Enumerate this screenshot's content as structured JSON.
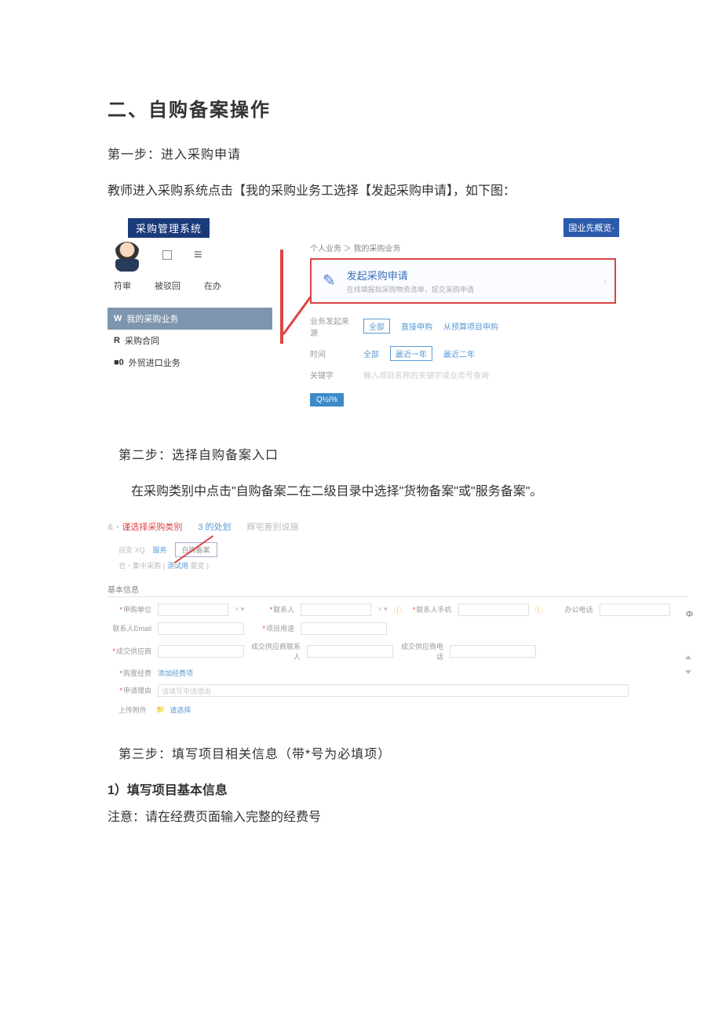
{
  "doc": {
    "title": "二、自购备案操作",
    "step1_title": "第一步：进入采购申请",
    "step1_body": "教师进入采购系统点击【我的采购业务工选择【发起采购申请】，如下图：",
    "step2_title": "第二步：选择自购备案入口",
    "step2_body": "在采购类别中点击\"自购备案二在二级目录中选择\"货物备案\"或\"服务备案\"。",
    "step3_title": "第三步：填写项目相关信息（带*号为必填项）",
    "step3_sub": "1）填写项目基本信息",
    "step3_note": "注意：请在经费页面输入完整的经费号"
  },
  "shot1": {
    "header_left": "采购管理系统",
    "header_right": "国业先概览-",
    "menu_icon": "≡",
    "row2": [
      "符审",
      "被驳回",
      "在办"
    ],
    "nav_active_prefix": "W",
    "nav_active": "我的采购业务",
    "nav_item2_prefix": "R",
    "nav_item2": "采购合同",
    "nav_item3_prefix": "■0",
    "nav_item3": "外贸进口业务",
    "breadcrumb": "个人业务  ＞  我的采购业务",
    "card_title": "发起采购申请",
    "card_sub": "在线填报拟采购物资清单，提交采购申请",
    "f1_label": "业务发起来源",
    "f1_all": "全部",
    "f1_opt1": "直接申购",
    "f1_opt2": "从预算项目申购",
    "f2_label": "时间",
    "f2_all": "全部",
    "f2_opt1": "最近一年",
    "f2_opt2": "最近二年",
    "f3_label": "关键字",
    "f3_ph": "输入项目名称的关键字或业务号查询",
    "search_btn": "Q½i%"
  },
  "shot2": {
    "top_prefix": "&・",
    "top1": "谨选择采购类别",
    "top2": "3 的处划",
    "top3": "辉宅差别说施",
    "tab_left": "目安 XQ",
    "tab1": "服务",
    "tab2": "自购备案",
    "sub_left": "也・集中采购 (",
    "sub_mid": "测试用",
    "sub_right": "曼变 )",
    "section1": "基本信息",
    "labels": {
      "unit": "申购单位",
      "contact": "联系人",
      "phone": "联系人手机",
      "office": "办公电话",
      "email": "联系人Email",
      "purpose": "项目用途",
      "supplier": "成交供应商",
      "sup_contact": "成交供应商联系人",
      "sup_phone": "成交供应商电话",
      "budget": "购置经费",
      "budget_link": "添加经费项",
      "reason": "申请理由",
      "reason_ph": "请填写申请理由",
      "upload": "上传附件",
      "upload_link": "请选择"
    },
    "x_mark": "×  ▾",
    "phi": "Φ"
  }
}
